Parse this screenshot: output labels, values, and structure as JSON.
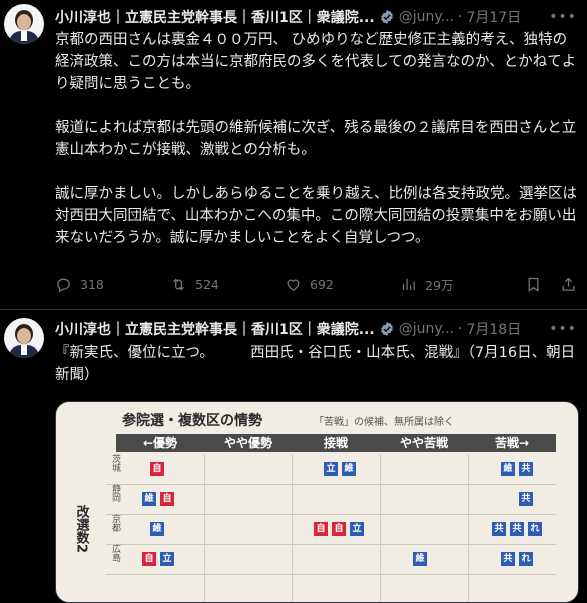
{
  "posts": [
    {
      "author": "小川淳也｜立憲民主党幹事長｜香川1区｜衆議院...",
      "handle": "@juny...",
      "date": "7月17日",
      "more_icon": "more-horizontal-icon",
      "paragraphs": [
        "京都の西田さんは裏金４００万円、 ひめゆりなど歴史修正主義的考え、独特の経済政策、この方は本当に京都府民の多くを代表しての発言なのか、とかねてより疑問に思うことも。",
        "報道によれば京都は先頭の維新候補に次ぎ、残る最後の２議席目を西田さんと立憲山本わかこが接戦、激戦との分析も。",
        "誠に厚かましい。しかしあらゆることを乗り越え、比例は各支持政党。選挙区は対西田大同団結で、山本わかこへの集中。この際大同団結の投票集中をお願い出来ないだろうか。誠に厚かましいことをよく自覚しつつ。"
      ],
      "replies": "318",
      "reposts": "524",
      "likes": "692",
      "views": "29万"
    },
    {
      "author": "小川淳也｜立憲民主党幹事長｜香川1区｜衆議院...",
      "handle": "@juny...",
      "date": "7月18日",
      "text": "『新実氏、優位に立つ。　　　西田氏・谷口氏・山本氏、混戦』（7月16日、朝日新聞）",
      "media": {
        "title": "参院選・複数区の情勢",
        "note": "「苦戦」の候補、無所属は除く",
        "columns": [
          "←優勢",
          "やや優勢",
          "接戦",
          "やや苦戦",
          "苦戦→"
        ],
        "side_label": "改選数2",
        "prefectures": [
          "茨城",
          "静岡",
          "京都",
          "広島"
        ],
        "chips": {
          "red": "自",
          "blue": "立",
          "ishin": "維",
          "kyo": "共",
          "reiwa": "れ"
        }
      }
    }
  ],
  "colors": {
    "background": "#000000",
    "text": "#e7e9ea",
    "muted": "#71767b",
    "verified": "#829aab"
  }
}
